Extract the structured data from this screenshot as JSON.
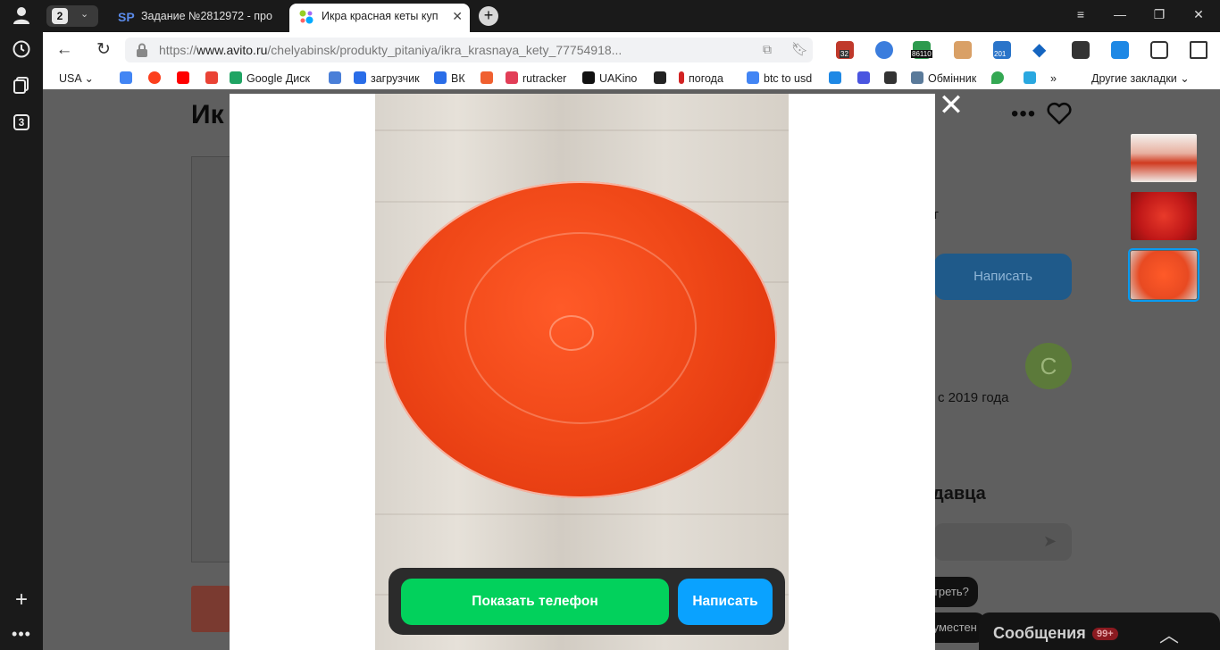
{
  "browser": {
    "tab_count": "2",
    "tabs": [
      {
        "label": "Задание №2812972 - про",
        "favicon": "SP"
      },
      {
        "label": "Икра красная кеты куп"
      }
    ],
    "url_prefix": "https://",
    "url_host": "www.avito.ru",
    "url_path": "/chelyabinsk/produkty_pitaniya/ikra_krasnaya_kety_77754918...",
    "sidebar_badge": "3",
    "ext_badges": [
      "32",
      "86110",
      "201"
    ]
  },
  "bookmarks": [
    {
      "label": "USA",
      "color": "#ffffff"
    },
    {
      "label": "",
      "color": "#4285f4"
    },
    {
      "label": "",
      "color": "#fc3f1d"
    },
    {
      "label": "",
      "color": "#ff0000"
    },
    {
      "label": "",
      "color": "#ea4335"
    },
    {
      "label": "Google Диск",
      "color": "#1fa463"
    },
    {
      "label": "",
      "color": "#4a7fd8"
    },
    {
      "label": "загрузчик",
      "color": "#2a6de8"
    },
    {
      "label": "ВК",
      "color": "#2a6de8"
    },
    {
      "label": "",
      "color": "#f06030"
    },
    {
      "label": "rutracker",
      "color": "#e23e57"
    },
    {
      "label": "UAKino",
      "color": "#111111"
    },
    {
      "label": "",
      "color": "#222222"
    },
    {
      "label": "погода",
      "color": "#d22222"
    },
    {
      "label": "btc to usd",
      "color": "#4285f4"
    },
    {
      "label": "",
      "color": "#1e88e5"
    },
    {
      "label": "",
      "color": "#4a55e0"
    },
    {
      "label": "",
      "color": "#333333"
    },
    {
      "label": "Обмінник",
      "color": "#5a7a9a"
    },
    {
      "label": "",
      "color": "#34a853"
    },
    {
      "label": "",
      "color": "#2aa8e0"
    }
  ],
  "bookmarks_more": "»",
  "bookmarks_other": "Другие закладки",
  "page": {
    "title_fragment": "Ик",
    "write_button": "Написать",
    "text_fragment_1": "т",
    "avatar_letter": "С",
    "since_text": "с 2019 года",
    "section_fragment": "давца",
    "chip_1": "ртреть?",
    "chip_2": "вуместен"
  },
  "messages": {
    "label": "Сообщения",
    "count": "99+"
  },
  "modal": {
    "show_phone_label": "Показать телефон",
    "write_label": "Написать",
    "close_symbol": "✕"
  },
  "thumbnails": [
    {
      "selected": false,
      "color": "#d8b0a8"
    },
    {
      "selected": false,
      "color": "#c81e1e"
    },
    {
      "selected": true,
      "color": "#e84a22"
    }
  ]
}
